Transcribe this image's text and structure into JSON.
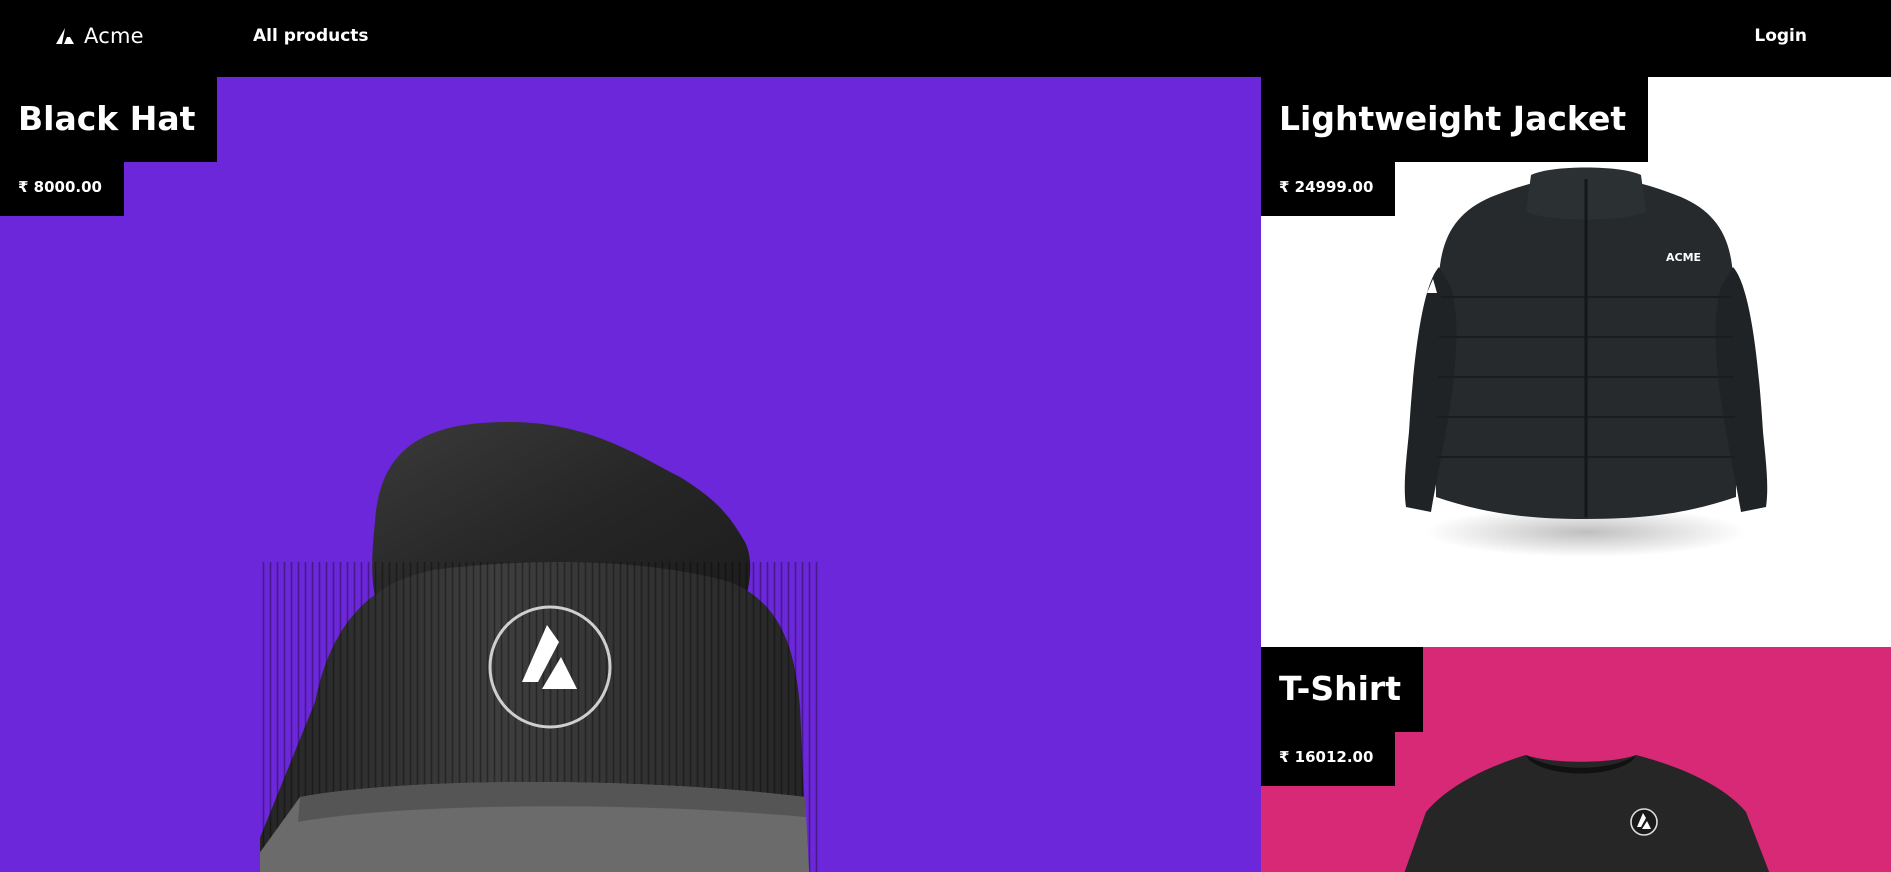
{
  "navbar": {
    "brand_name": "Acme",
    "all_products_label": "All products",
    "login_label": "Login"
  },
  "products": [
    {
      "title": "Black Hat",
      "price": "₹ 8000.00",
      "background": "#6b27d9"
    },
    {
      "title": "Lightweight Jacket",
      "price": "₹ 24999.00",
      "background": "#ffffff",
      "print": "ACME"
    },
    {
      "title": "T-Shirt",
      "price": "₹ 16012.00",
      "background": "#d82977"
    }
  ],
  "icons": [
    "acme-logo-icon"
  ]
}
